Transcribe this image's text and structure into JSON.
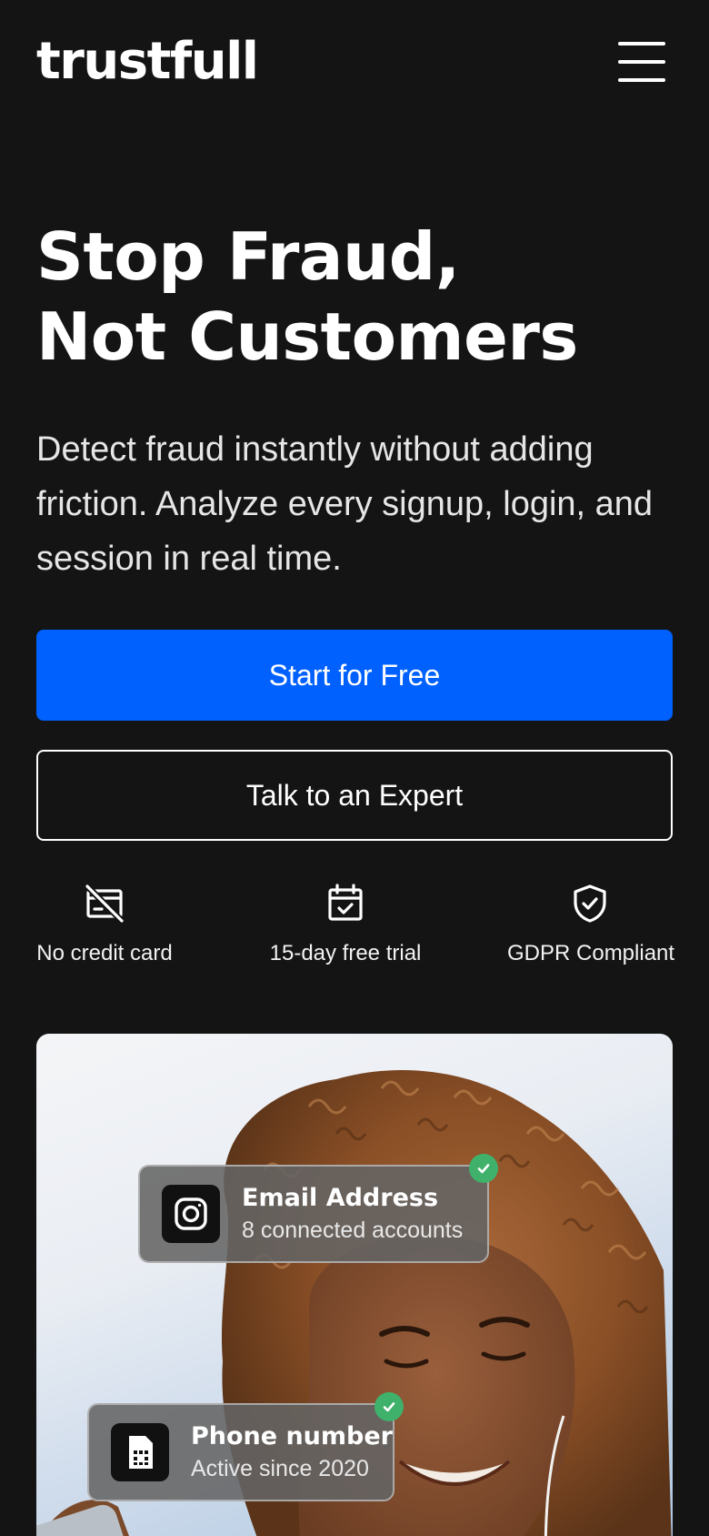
{
  "header": {
    "logo_text": "trustfull",
    "menu_icon": "hamburger-menu-icon"
  },
  "hero": {
    "title_line1": "Stop Fraud,",
    "title_line2": "Not Customers",
    "subtitle": "Detect fraud instantly without adding friction. Analyze every signup, login, and session in real time."
  },
  "cta": {
    "primary_label": "Start for Free",
    "secondary_label": "Talk to an Expert"
  },
  "features": [
    {
      "icon": "no-credit-card-icon",
      "label": "No credit card"
    },
    {
      "icon": "calendar-check-icon",
      "label": "15-day free trial"
    },
    {
      "icon": "shield-check-icon",
      "label": "GDPR Compliant"
    }
  ],
  "cards": {
    "email": {
      "icon": "instagram-icon",
      "title": "Email Address",
      "subtitle": "8 connected accounts"
    },
    "phone": {
      "icon": "sim-card-icon",
      "title": "Phone number",
      "subtitle": "Active since 2020"
    }
  },
  "colors": {
    "background": "#141414",
    "primary": "#0061ff",
    "success": "#3fb16b",
    "text": "#ffffff"
  }
}
